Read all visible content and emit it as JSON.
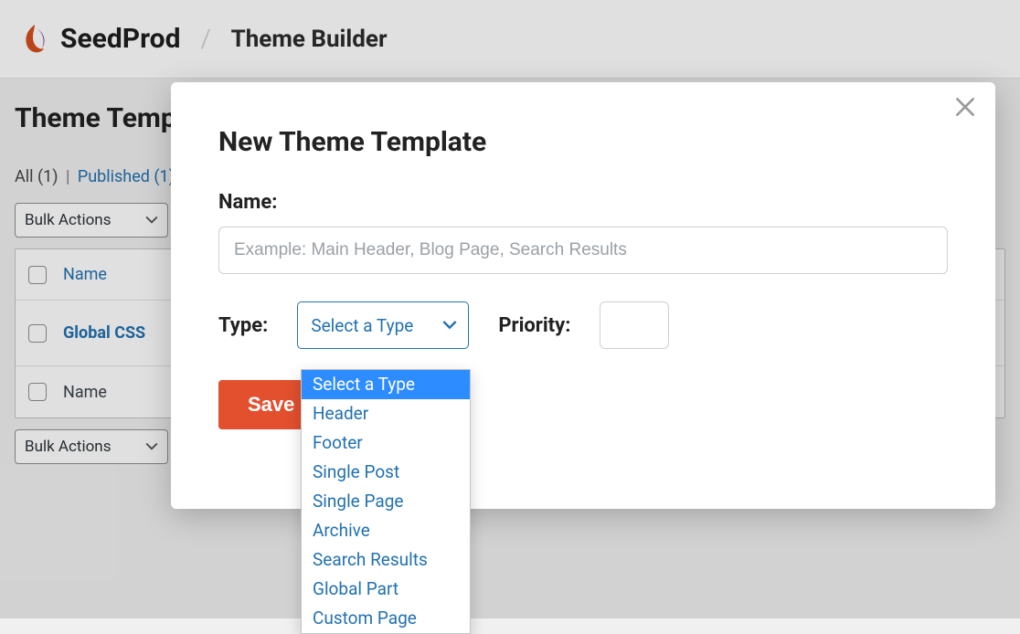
{
  "header": {
    "brand": "SeedProd",
    "separator": "/",
    "breadcrumb": "Theme Builder"
  },
  "page": {
    "title": "Theme Templates",
    "filters": {
      "all_label": "All",
      "all_count": "(1)",
      "published_label": "Published",
      "published_count": "(1)"
    },
    "bulk_actions_label": "Bulk Actions",
    "table": {
      "header_name": "Name",
      "footer_name": "Name",
      "rows": [
        {
          "name": "Global CSS"
        }
      ]
    }
  },
  "modal": {
    "title": "New Theme Template",
    "name_label": "Name:",
    "name_placeholder": "Example: Main Header, Blog Page, Search Results",
    "type_label": "Type:",
    "type_selected": "Select a Type",
    "priority_label": "Priority:",
    "save_label": "Save",
    "type_options": [
      "Select a Type",
      "Header",
      "Footer",
      "Single Post",
      "Single Page",
      "Archive",
      "Search Results",
      "Global Part",
      "Custom Page"
    ]
  }
}
